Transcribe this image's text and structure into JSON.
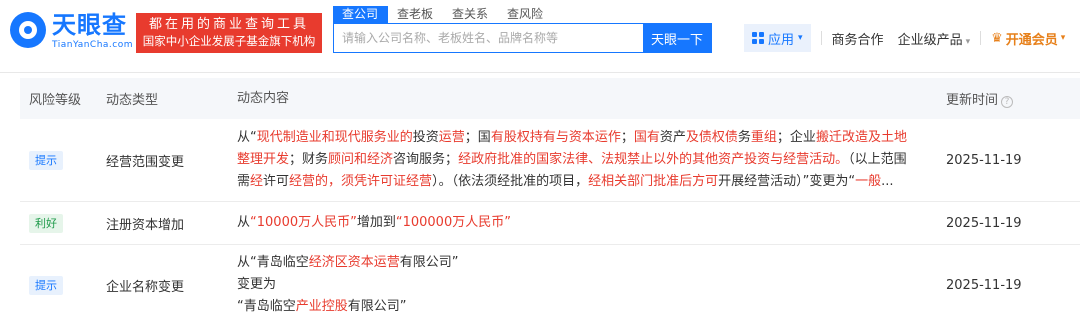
{
  "logo": {
    "cn": "天眼查",
    "en": "TianYanCha.com"
  },
  "slogan": {
    "line1": "都在用的商业查询工具",
    "line2": "国家中小企业发展子基金旗下机构"
  },
  "search": {
    "tabs": [
      "查公司",
      "查老板",
      "查关系",
      "查风险"
    ],
    "placeholder": "请输入公司名称、老板姓名、品牌名称等",
    "button": "天眼一下"
  },
  "nav": {
    "app": "应用",
    "business": "商务合作",
    "enterprise": "企业级产品",
    "vip": "开通会员"
  },
  "table": {
    "headers": {
      "risk": "风险等级",
      "type": "动态类型",
      "content": "动态内容",
      "time": "更新时间"
    },
    "rows": [
      {
        "badge": "提示",
        "type": "经营范围变更",
        "lines": [
          [
            [
              "n",
              "从“"
            ],
            [
              "h",
              "现代制造业和现代服务业的"
            ],
            [
              "n",
              "投资"
            ],
            [
              "h",
              "运营"
            ],
            [
              "n",
              "；国"
            ],
            [
              "h",
              "有股权持有与资本运作"
            ],
            [
              "n",
              "；"
            ],
            [
              "h",
              "国有"
            ],
            [
              "n",
              "资产"
            ],
            [
              "h",
              "及债权债"
            ],
            [
              "n",
              "务"
            ],
            [
              "h",
              "重组"
            ],
            [
              "n",
              "；企业"
            ],
            [
              "h",
              "搬迁改造及土地"
            ]
          ],
          [
            [
              "h",
              "整理开发"
            ],
            [
              "n",
              "；财务"
            ],
            [
              "h",
              "顾问和经济"
            ],
            [
              "n",
              "咨询服务；"
            ],
            [
              "h",
              "经政府批准的国家法律、法规禁止以外的其他资产投资与经营活动。"
            ],
            [
              "n",
              "（以上范围"
            ]
          ],
          [
            [
              "n",
              "需"
            ],
            [
              "h",
              "经"
            ],
            [
              "n",
              "许可"
            ],
            [
              "h",
              "经营的，须凭许可证经营"
            ],
            [
              "n",
              "）。（依法须经批准的项目，"
            ],
            [
              "h",
              "经相关部门批准后方可"
            ],
            [
              "n",
              "开展经营活动）”变更为“"
            ],
            [
              "h",
              "一般"
            ],
            [
              "n",
              "..."
            ]
          ]
        ],
        "time": "2025-11-19"
      },
      {
        "badge": "利好",
        "type": "注册资本增加",
        "lines": [
          [
            [
              "n",
              "从"
            ],
            [
              "h",
              "“10000万人民币”"
            ],
            [
              "n",
              "增加到"
            ],
            [
              "h",
              "“100000万人民币”"
            ]
          ]
        ],
        "time": "2025-11-19"
      },
      {
        "badge": "提示",
        "type": "企业名称变更",
        "lines": [
          [
            [
              "n",
              "从“青岛临空"
            ],
            [
              "h",
              "经济区资本运营"
            ],
            [
              "n",
              "有限公司”"
            ]
          ],
          [
            [
              "n",
              "变更为"
            ]
          ],
          [
            [
              "n",
              "“青岛临空"
            ],
            [
              "h",
              "产业控股"
            ],
            [
              "n",
              "有限公司”"
            ]
          ]
        ],
        "time": "2025-11-19"
      }
    ]
  },
  "colors": {
    "accent": "#1677ff",
    "highlight": "#e83b2e",
    "good": "#1e9a4a",
    "vip": "#e7801a"
  }
}
